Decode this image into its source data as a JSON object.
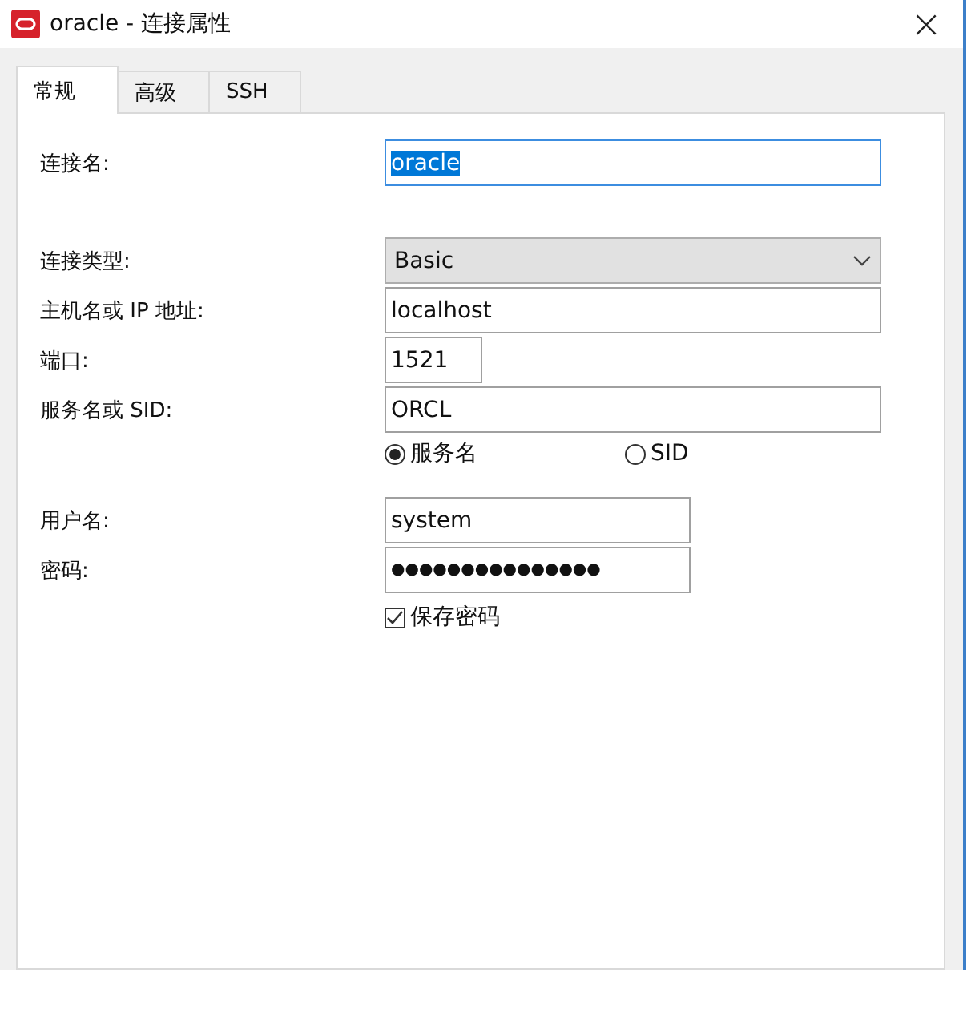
{
  "window": {
    "title": "oracle - 连接属性",
    "close": "×"
  },
  "tabs": [
    {
      "label": "常规",
      "selected": true
    },
    {
      "label": "高级",
      "selected": false
    },
    {
      "label": "SSH",
      "selected": false
    }
  ],
  "rows": [
    {
      "kind": "text",
      "label": "连接名:",
      "value": "oracle",
      "focused": true
    },
    {
      "kind": "select",
      "label": "连接类型:",
      "value": "Basic"
    },
    {
      "kind": "text",
      "label": "主机名或 IP 地址:",
      "value": "localhost",
      "focused": false
    },
    {
      "kind": "number",
      "label": "端口:",
      "value": "1521",
      "focused": false
    },
    {
      "kind": "text",
      "label": "服务名或 SID:",
      "value": "ORCL",
      "focused": false
    },
    {
      "kind": "radio",
      "options": [
        {
          "label": "服务名",
          "selected": true
        },
        {
          "label": "SID",
          "selected": false
        }
      ]
    },
    {
      "kind": "login",
      "label": "用户名:",
      "value": "system",
      "focused": false
    },
    {
      "kind": "password",
      "label": "密码:",
      "value": "●●●●●●●●●●●●●●●",
      "focused": false
    },
    {
      "kind": "checkbox",
      "label": "保存密码",
      "checked": true
    }
  ]
}
